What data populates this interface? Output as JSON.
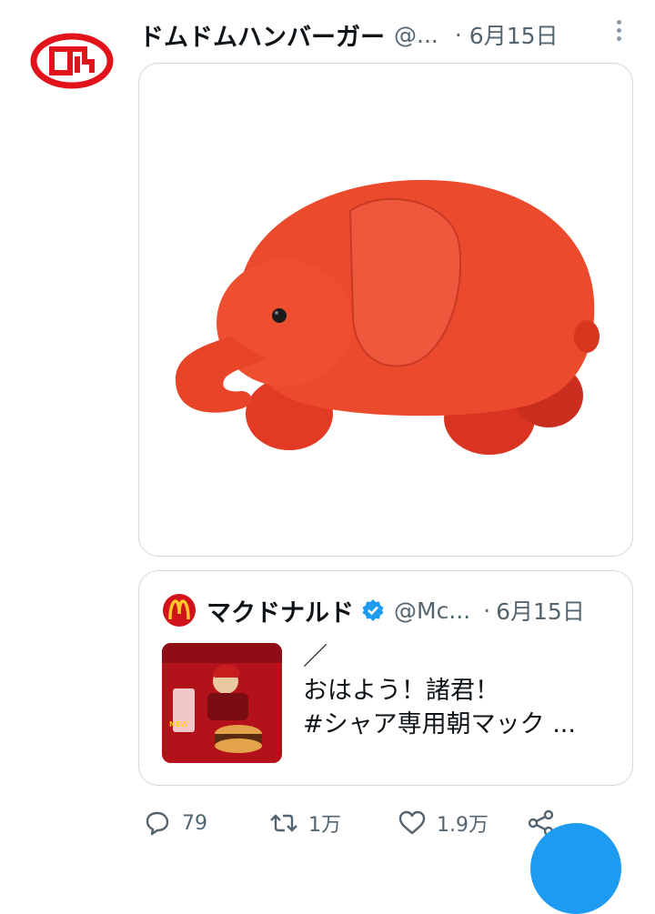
{
  "tweet": {
    "author_name": "ドムドムハンバーガー",
    "author_handle": "@...",
    "date": "6月15日",
    "avatar_icon": "domdom-logo-icon",
    "media_icon": "red-elephant-plush-image"
  },
  "quote": {
    "author_name": "マクドナルド",
    "author_handle": "@Mc...",
    "date": "6月15日",
    "verified_icon": "verified-badge-icon",
    "logo_icon": "mcdonalds-logo-icon",
    "thumbnail_icon": "char-breakfast-promo-image",
    "text_lines": [
      "／",
      "おはよう！諸君！",
      "#シャア専用朝マック ..."
    ]
  },
  "actions": {
    "reply": {
      "icon": "reply-icon",
      "count": "79"
    },
    "retweet": {
      "icon": "retweet-icon",
      "count": "1万"
    },
    "like": {
      "icon": "heart-icon",
      "count": "1.9万"
    },
    "share": {
      "icon": "share-icon"
    }
  },
  "colors": {
    "brand_red": "#e3131b",
    "secondary_text": "#536471",
    "verified_blue": "#1d9bf0",
    "border": "#cfd9de"
  }
}
